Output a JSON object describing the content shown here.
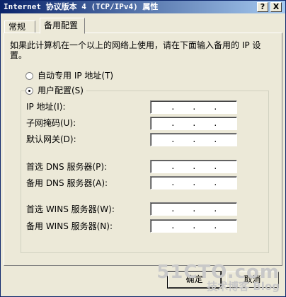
{
  "window": {
    "title": "Internet 协议版本 4 (TCP/IPv4) 属性",
    "help_button": "?",
    "close_button": "X"
  },
  "tabs": [
    {
      "label": "常规"
    },
    {
      "label": "备用配置"
    }
  ],
  "panel": {
    "description": "如果此计算机在一个以上的网络上使用，请在下面输入备用的 IP 设置。",
    "radio_auto": "自动专用 IP 地址(T)",
    "radio_user": "用户配置(S)",
    "fields": [
      {
        "label": "IP 地址(I):"
      },
      {
        "label": "子网掩码(U):"
      },
      {
        "label": "默认网关(D):"
      },
      {
        "label": "首选 DNS 服务器(P):"
      },
      {
        "label": "备用 DNS 服务器(A):"
      },
      {
        "label": "首选 WINS 服务器(W):"
      },
      {
        "label": "备用 WINS 服务器(N):"
      }
    ],
    "ip_dots": "."
  },
  "buttons": {
    "ok": "确定",
    "cancel": "取消"
  },
  "watermark": {
    "line1": "51CTO.com",
    "line2": "技术博客 Blog"
  }
}
